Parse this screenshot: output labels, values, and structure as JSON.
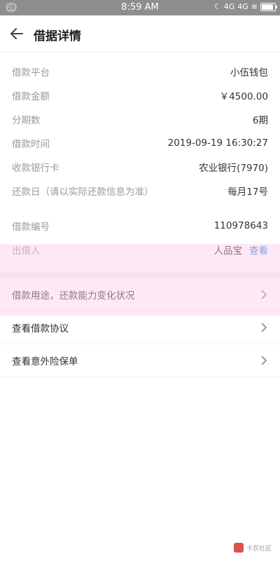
{
  "status_bar": {
    "badge": "28",
    "time": "8:59 AM",
    "signal_1": "4G",
    "signal_2": "4G"
  },
  "header": {
    "title": "借据详情"
  },
  "details": [
    {
      "label": "借款平台",
      "value": "小伍钱包"
    },
    {
      "label": "借款金额",
      "value": "￥4500.00"
    },
    {
      "label": "分期数",
      "value": "6期"
    },
    {
      "label": "借款时间",
      "value": "2019-09-19 16:30:27"
    },
    {
      "label": "收款银行卡",
      "value": "农业银行(7970)"
    },
    {
      "label": "还款日（请以实际还款信息为准）",
      "value": "每月17号"
    }
  ],
  "details2": [
    {
      "label": "借款编号",
      "value": "110978643"
    },
    {
      "label": "出借人",
      "value": "人品宝",
      "link": "查看"
    }
  ],
  "nav": [
    {
      "label": "借款用途，还款能力变化状况"
    },
    {
      "label": "查看借款协议"
    },
    {
      "label": "查看意外险保单"
    }
  ],
  "watermark": {
    "text": "卡农社区"
  }
}
